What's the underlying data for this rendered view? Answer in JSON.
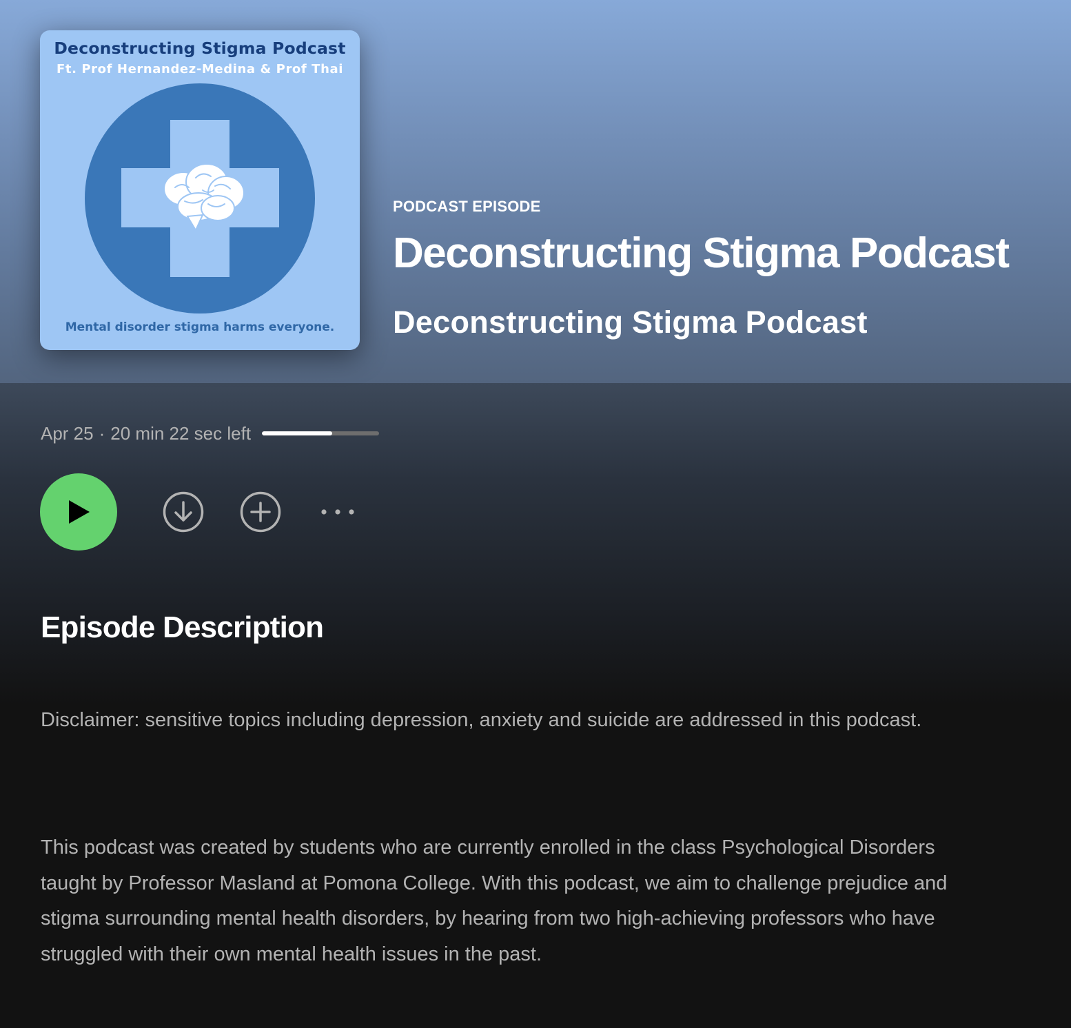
{
  "cover": {
    "line1": "Deconstructing Stigma Podcast",
    "line2": "Ft. Prof Hernandez-Medina & Prof Thai",
    "tagline": "Mental disorder stigma harms everyone.",
    "colors": {
      "background": "#9ec6f4",
      "circle": "#3a77b8",
      "title": "#173e7c",
      "tagline": "#2f67a6"
    }
  },
  "header": {
    "type_label": "PODCAST EPISODE",
    "episode_title": "Deconstructing Stigma Podcast",
    "show_name": "Deconstructing Stigma Podcast"
  },
  "episode": {
    "date": "Apr 25",
    "separator": "·",
    "time_left": "20 min 22 sec left",
    "progress_fraction": 0.6
  },
  "actions": {
    "play_icon": "play-icon",
    "download_icon": "download-circle-icon",
    "add_icon": "plus-circle-icon",
    "more_icon": "more-horizontal-icon",
    "play_color": "#64d26e"
  },
  "description": {
    "heading": "Episode Description",
    "paragraphs": [
      "Disclaimer: sensitive topics including depression, anxiety and suicide are addressed in this podcast.",
      "This podcast was created by students who are currently enrolled in the class Psychological Disorders taught by Professor Masland at Pomona College. With this podcast, we aim to challenge prejudice and stigma surrounding mental health disorders, by hearing from two high-achieving professors who have struggled with their own mental health issues in the past."
    ]
  }
}
